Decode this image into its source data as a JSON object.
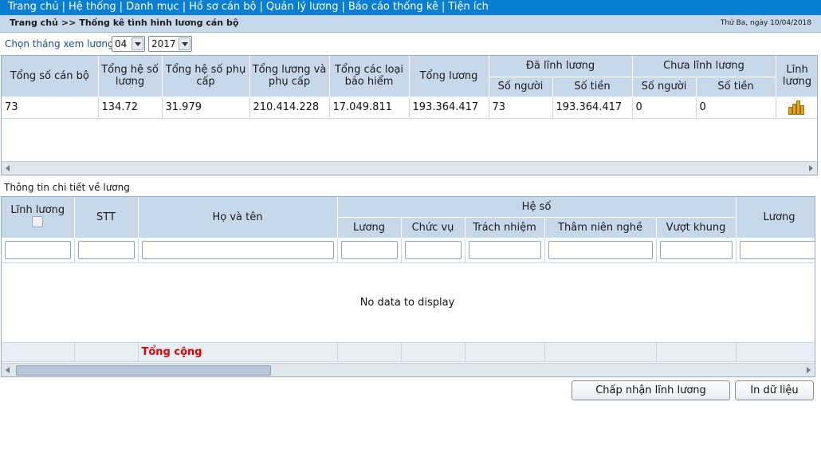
{
  "menu": [
    "Trang chủ",
    "Hệ thống",
    "Danh mục",
    "Hồ sơ cán bộ",
    "Quản lý lương",
    "Báo cáo thống kê",
    "Tiện ích"
  ],
  "breadcrumb": {
    "home": "Trang chủ",
    "separator": ">>",
    "current": "Thống kê tình hình lương cán bộ"
  },
  "date_text": "Thứ Ba, ngày 10/04/2018",
  "month_select": {
    "label": "Chọn tháng xem lương",
    "month": "04",
    "year": "2017"
  },
  "summary": {
    "headers": {
      "tong_so_can_bo": "Tổng số cán bộ",
      "tong_he_so_luong": "Tổng hệ số lương",
      "tong_he_so_phu_cap": "Tổng hệ số phụ cấp",
      "tong_luong_phu_cap": "Tổng lương và phụ cấp",
      "tong_bao_hiem": "Tổng các loại bảo hiểm",
      "tong_luong": "Tổng lương",
      "da_linh_luong": "Đã lĩnh lương",
      "chua_linh_luong": "Chưa lĩnh lương",
      "so_nguoi": "Số người",
      "so_tien": "Số tiền",
      "linh_luong": "Lĩnh lương"
    },
    "row": {
      "tong_so_can_bo": "73",
      "tong_he_so_luong": "134.72",
      "tong_he_so_phu_cap": "31.979",
      "tong_luong_phu_cap": "210.414.228",
      "tong_bao_hiem": "17.049.811",
      "tong_luong": "193.364.417",
      "da_so_nguoi": "73",
      "da_so_tien": "193.364.417",
      "chua_so_nguoi": "0",
      "chua_so_tien": "0"
    },
    "action_icon": "coins-icon"
  },
  "detail": {
    "title": "Thông tin chi tiết về lương",
    "headers": {
      "linh_luong": "Lĩnh lương",
      "stt": "STT",
      "ho_ten": "Họ và tên",
      "he_so": "Hệ số",
      "luong": "Lương",
      "chuc_vu": "Chức vụ",
      "trach_nhiem": "Trách nhiệm",
      "tham_nien_nghe": "Thâm niên nghề",
      "vuot_khung": "Vượt khung",
      "luong_col": "Lương"
    },
    "no_data": "No data to display",
    "total_label": "Tổng cộng"
  },
  "buttons": {
    "accept": "Chấp nhận lĩnh lương",
    "print": "In dữ liệu"
  },
  "colors": {
    "menu_bg": "#0a7fd1",
    "header_bg": "#c6d8ea",
    "total_text": "#e00000"
  }
}
